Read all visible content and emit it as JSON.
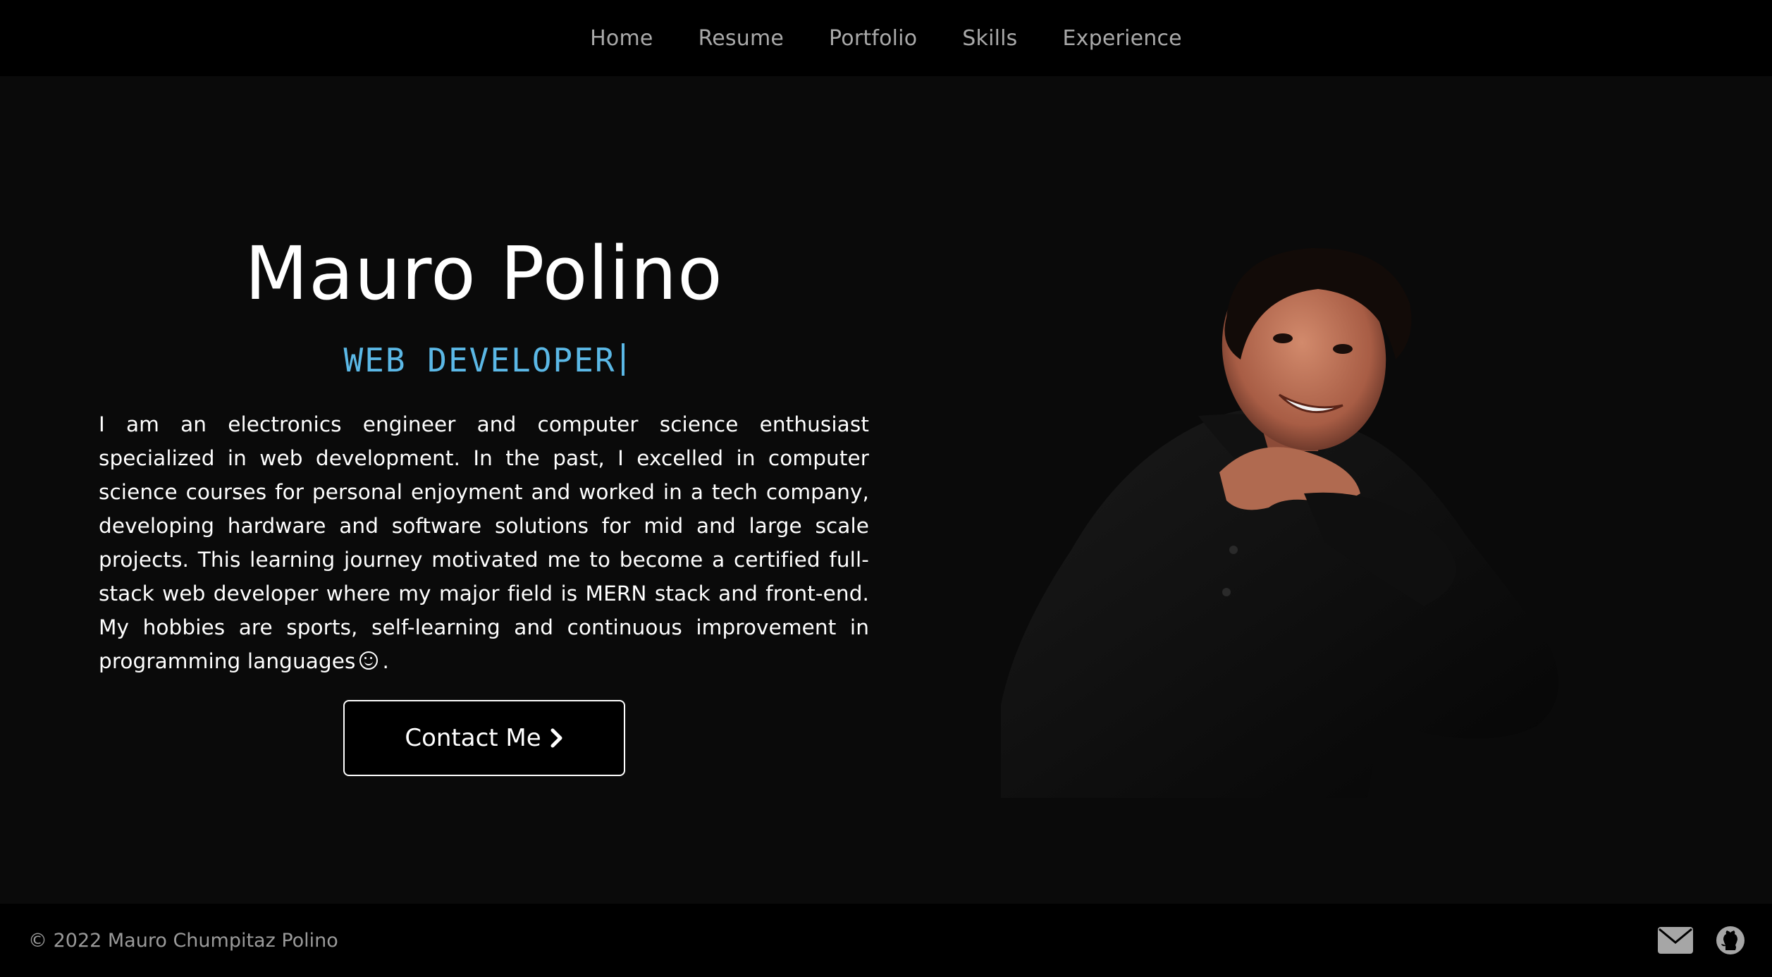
{
  "nav": {
    "items": [
      {
        "label": "Home"
      },
      {
        "label": "Resume"
      },
      {
        "label": "Portfolio"
      },
      {
        "label": "Skills"
      },
      {
        "label": "Experience"
      }
    ]
  },
  "hero": {
    "name": "Mauro Polino",
    "role": "WEB DEVELOPER",
    "bio": "I am an electronics engineer and computer science enthusiast specialized in web development. In the past, I excelled in computer science courses for personal enjoyment and worked in a tech company, developing hardware and software solutions for mid and large scale projects. This learning journey motivated me to become a certified full-stack web developer where my major field is MERN stack and front-end. My hobbies are sports, self-learning and continuous improvement in programming languages",
    "bio_end": ".",
    "contact_label": "Contact Me"
  },
  "footer": {
    "copyright": "© 2022 Mauro Chumpitaz Polino",
    "icons": [
      "envelope-icon",
      "github-icon"
    ]
  },
  "colors": {
    "accent": "#5bb8e6",
    "background": "#0a0a0a",
    "bar": "#000000",
    "nav_text": "#a9a9a9"
  }
}
